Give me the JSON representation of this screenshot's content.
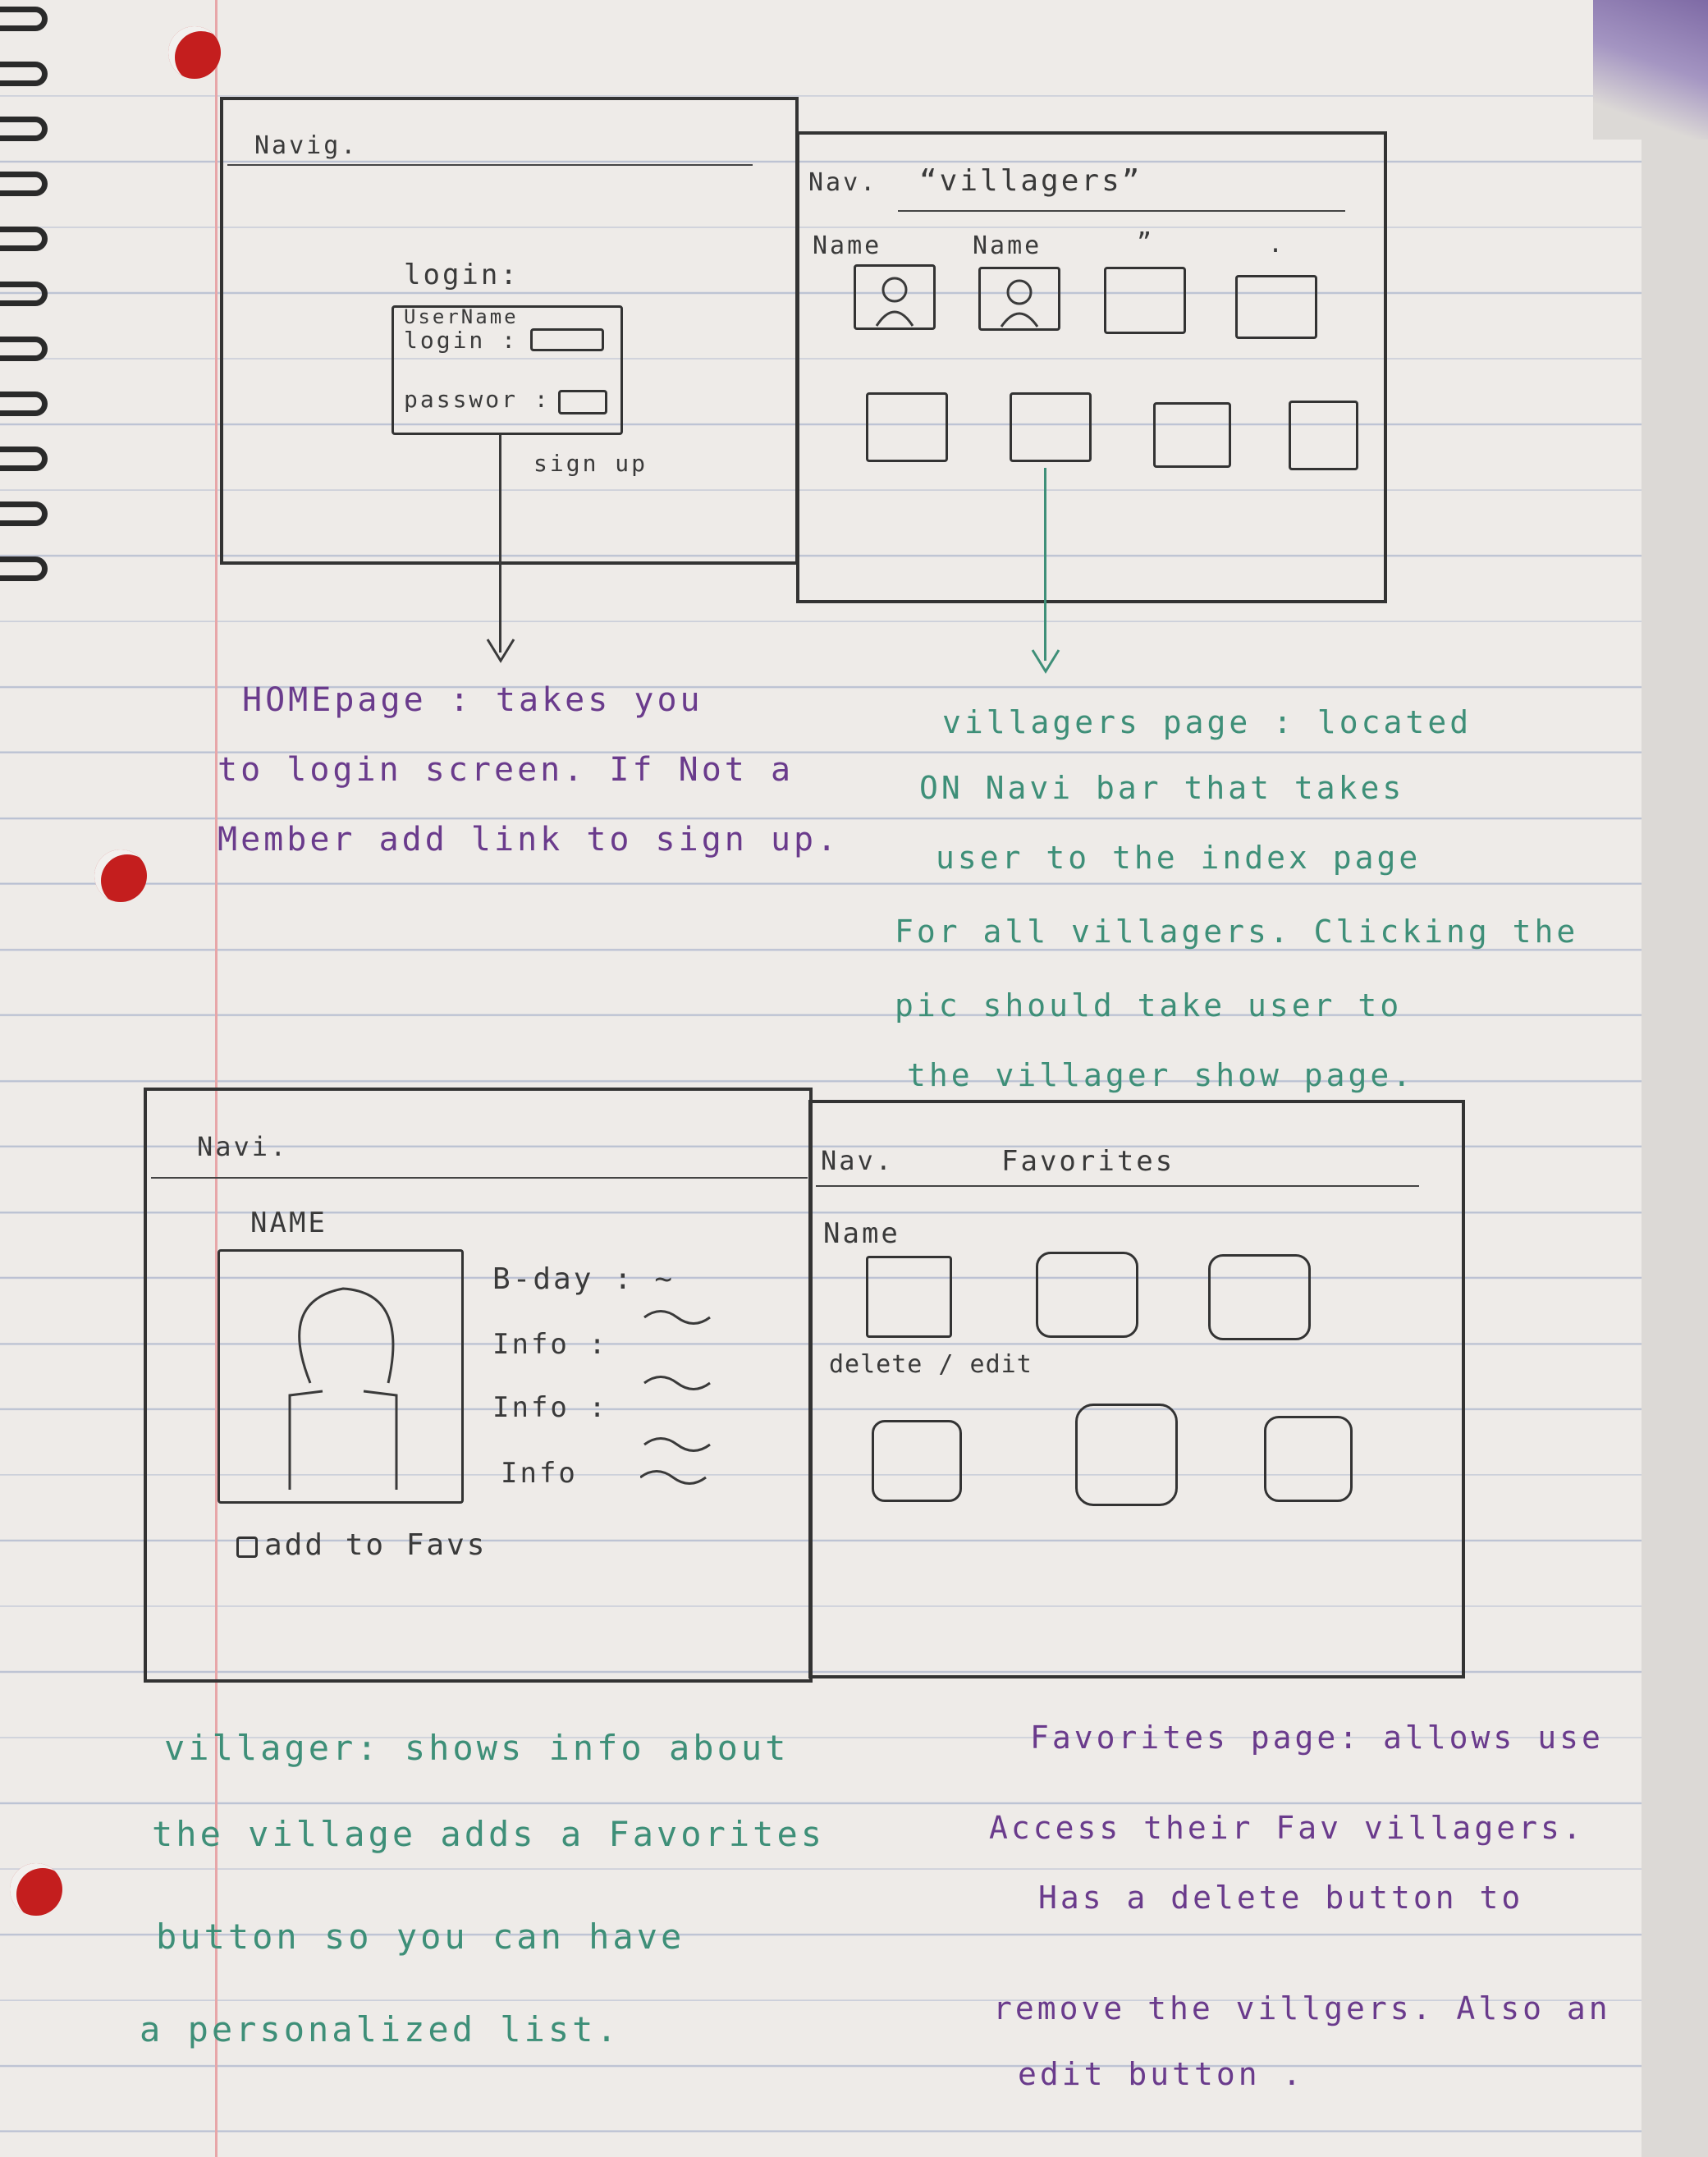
{
  "wireframes": {
    "home": {
      "nav": "Navig.",
      "login_title": "login:",
      "username_label": "UserName",
      "login_label": "login :",
      "password_label": "passwor :",
      "signup_link": "sign up"
    },
    "villagers": {
      "nav": "Nav.",
      "title": "“villagers”",
      "col1": "Name",
      "col2": "Name",
      "col3": "”",
      "col4": "."
    },
    "villager": {
      "nav": "Navi.",
      "name": "NAME",
      "fields": [
        "B-day : ~",
        "Info :",
        "Info :",
        "Info"
      ],
      "add_button": "add to Favs"
    },
    "favorites": {
      "nav": "Nav.",
      "title": "Favorites",
      "name": "Name",
      "actions": "delete / edit"
    }
  },
  "notes": {
    "homepage": [
      "HOMEpage : takes you",
      "to login screen. If Not a",
      "Member add link to sign up."
    ],
    "villagers_page": [
      "villagers page : located",
      "ON Navi bar that takes",
      "user to the index page",
      "For all villagers. Clicking the",
      "pic should take user to",
      "the villager show page."
    ],
    "villager": [
      "villager: shows info about",
      "the village adds a Favorites",
      "button so you can have",
      "a personalized list."
    ],
    "favorites_page": [
      "Favorites page: allows use",
      "Access their Fav villagers.",
      "Has a delete button to",
      "remove the villgers. Also an",
      "edit button ."
    ]
  },
  "colors": {
    "pencil": "#3a3a3a",
    "purple_ink": "#6a3b8c",
    "green_ink": "#3e8f78",
    "hole_red": "#c41e1e"
  }
}
